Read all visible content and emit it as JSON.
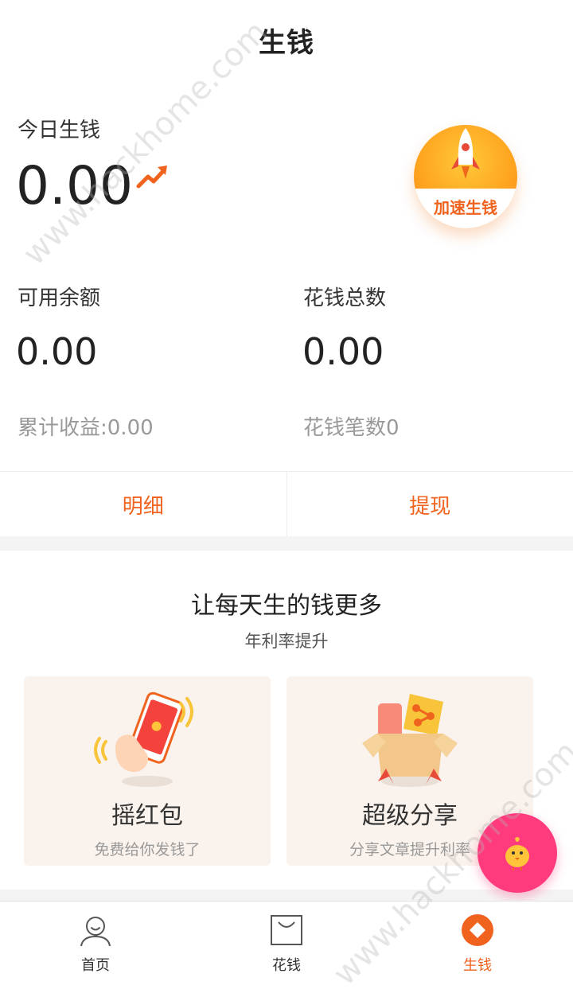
{
  "header": {
    "title": "生钱"
  },
  "today": {
    "label": "今日生钱",
    "value": "0.00"
  },
  "boost": {
    "label": "加速生钱"
  },
  "balance": {
    "label": "可用余额",
    "value": "0.00",
    "sub": "累计收益:0.00"
  },
  "spend": {
    "label": "花钱总数",
    "value": "0.00",
    "sub": "花钱笔数0"
  },
  "actions": {
    "detail": "明细",
    "withdraw": "提现"
  },
  "promo": {
    "title": "让每天生的钱更多",
    "subtitle": "年利率提升",
    "cards": [
      {
        "title": "摇红包",
        "subtitle": "免费给你发钱了"
      },
      {
        "title": "超级分享",
        "subtitle": "分享文章提升利率"
      }
    ]
  },
  "tabbar": {
    "items": [
      {
        "label": "首页"
      },
      {
        "label": "花钱"
      },
      {
        "label": "生钱"
      }
    ],
    "active": "生钱"
  },
  "watermark": "www.hackhome.com",
  "colors": {
    "accent": "#f0631e",
    "fab": "#ff3b7e",
    "card_bg": "#faf2ec"
  }
}
